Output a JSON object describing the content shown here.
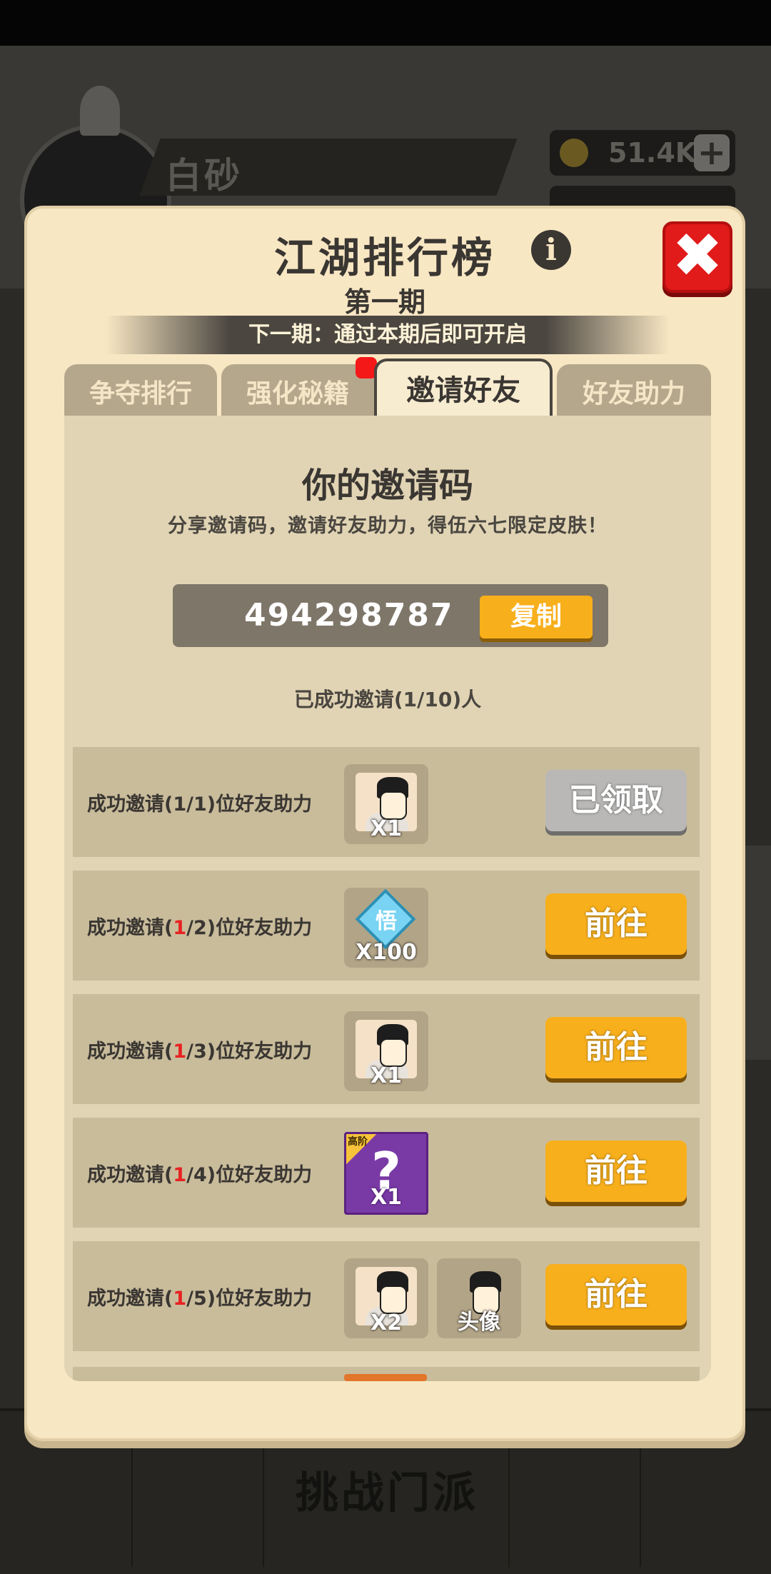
{
  "background": {
    "player_name": "白砂",
    "gold_amount": "51.4K",
    "bottom_title": "挑战门派"
  },
  "modal": {
    "title": "江湖排行榜",
    "period": "第一期",
    "next_period_banner": "下一期：通过本期后即可开启",
    "close_symbol": "✖",
    "info_symbol": "i"
  },
  "tabs": [
    {
      "label": "争夺排行",
      "active": false
    },
    {
      "label": "强化秘籍",
      "active": false,
      "has_badge": true
    },
    {
      "label": "邀请好友",
      "active": true
    },
    {
      "label": "好友助力",
      "active": false
    }
  ],
  "invite": {
    "title": "你的邀请码",
    "description": "分享邀请码，邀请好友助力，得伍六七限定皮肤！",
    "code": "494298787",
    "copy_label": "复制",
    "invited_status": "已成功邀请(1/10)人"
  },
  "rewards": [
    {
      "pre": "成功邀请(",
      "done": "1",
      "rest": "/1)位好友助力",
      "done_highlight": false,
      "items": [
        {
          "icon": "character-skin-icon",
          "qty": "X1"
        }
      ],
      "button": "已领取",
      "claimed": true
    },
    {
      "pre": "成功邀请(",
      "done": "1",
      "rest": "/2)位好友助力",
      "done_highlight": true,
      "items": [
        {
          "icon": "diamond-gem-icon",
          "gem_char": "悟",
          "qty": "X100"
        }
      ],
      "button": "前往",
      "claimed": false
    },
    {
      "pre": "成功邀请(",
      "done": "1",
      "rest": "/3)位好友助力",
      "done_highlight": true,
      "items": [
        {
          "icon": "character-skin-icon",
          "qty": "X1"
        }
      ],
      "button": "前往",
      "claimed": false
    },
    {
      "pre": "成功邀请(",
      "done": "1",
      "rest": "/4)位好友助力",
      "done_highlight": true,
      "items": [
        {
          "icon": "mystery-box-icon",
          "tag": "高阶",
          "symbol": "?",
          "qty": "X1"
        }
      ],
      "button": "前往",
      "claimed": false
    },
    {
      "pre": "成功邀请(",
      "done": "1",
      "rest": "/5)位好友助力",
      "done_highlight": true,
      "items": [
        {
          "icon": "character-skin-icon",
          "qty": "X2"
        },
        {
          "icon": "avatar-frame-icon",
          "qty": "头像"
        }
      ],
      "button": "前往",
      "claimed": false
    }
  ],
  "colors": {
    "accent_orange": "#f8af1c",
    "close_red": "#e11a1a",
    "progress_red": "#e82222"
  }
}
